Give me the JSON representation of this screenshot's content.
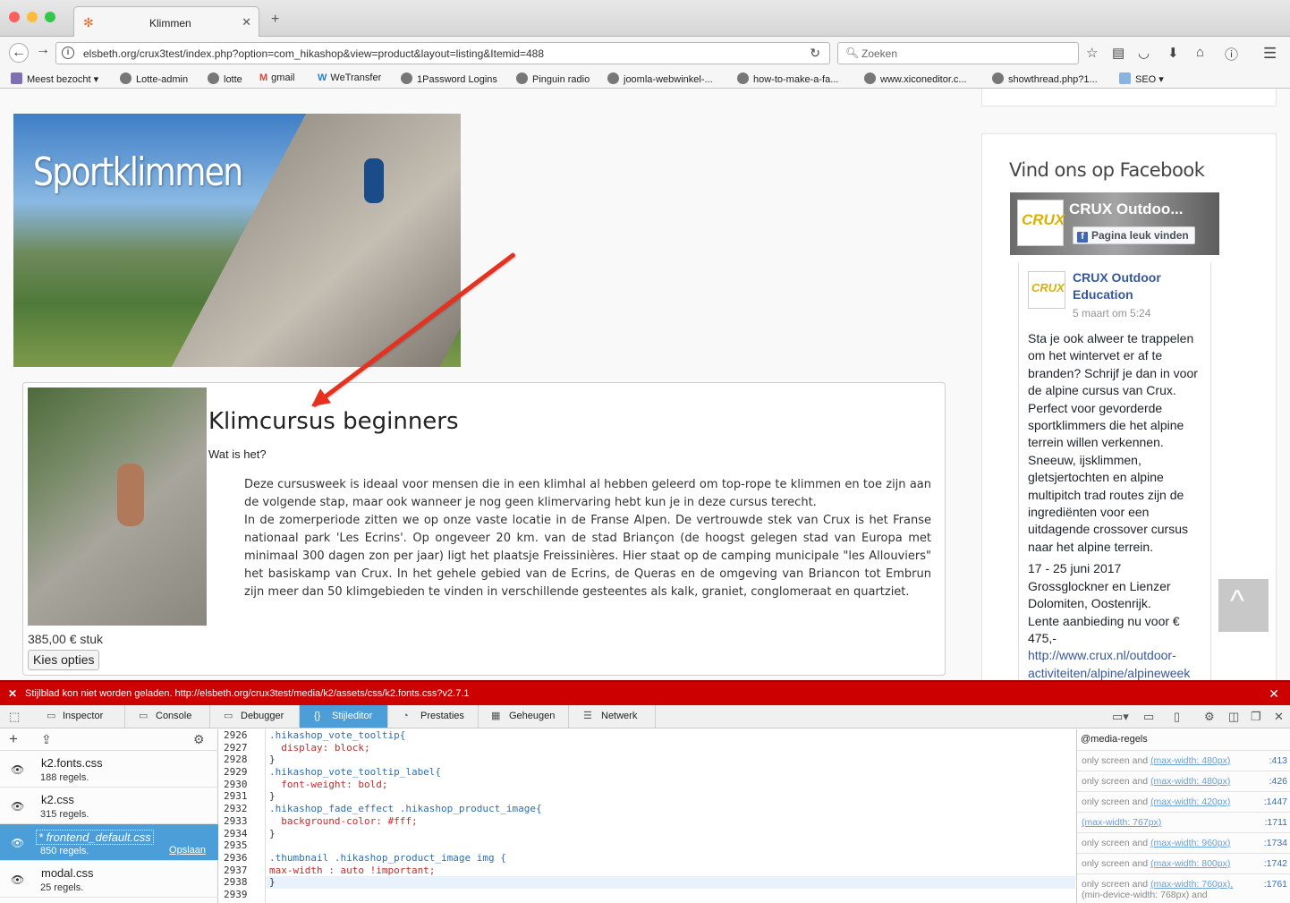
{
  "browser": {
    "tab_title": "Klimmen",
    "url": "elsbeth.org/crux3test/index.php?option=com_hikashop&view=product&layout=listing&Itemid=488",
    "search_placeholder": "Zoeken",
    "bookmarks": [
      "Meest bezocht",
      "Lotte-admin",
      "lotte",
      "gmail",
      "WeTransfer",
      "1Password Logins",
      "Pinguin radio",
      "joomla-webwinkel-...",
      "how-to-make-a-fa...",
      "www.xiconeditor.c...",
      "showthread.php?1...",
      "SEO"
    ]
  },
  "banner": {
    "title": "Sportklimmen"
  },
  "product": {
    "title": "Klimcursus beginners",
    "subtitle": "Wat is het?",
    "desc1": "Deze cursusweek is ideaal voor mensen die in een klimhal al hebben geleerd om top-rope te klimmen en toe zijn aan de volgende stap, maar ook wanneer je nog geen klimervaring hebt kun je in deze cursus terecht.",
    "desc2": "In de zomerperiode zitten we op onze vaste locatie in de Franse Alpen. De vertrouwde stek van Crux is het Franse nationaal park 'Les Ecrins'. Op ongeveer 20 km. van de stad Briançon (de hoogst gelegen stad van Europa met minimaal 300 dagen zon per jaar) ligt het plaatsje Freissinières. Hier staat op de camping municipale \"les Allouviers\" het basiskamp van Crux. In het gehele gebied van de Ecrins, de Queras en de omgeving van Briancon tot Embrun zijn meer dan 50 klimgebieden te vinden in verschillende gesteentes als kalk, graniet, conglomeraat en quartziet.",
    "price": "385,00 € stuk",
    "button": "Kies opties"
  },
  "sidebar": {
    "title": "Vind ons op Facebook",
    "page_name": "CRUX Outdoo...",
    "like": "Pagina leuk vinden",
    "logo_text": "CRUX",
    "post_name": "CRUX Outdoor Education",
    "post_date": "5 maart om 5:24",
    "post_text": "Sta je ook alweer te trappelen om het wintervet er af te branden? Schrijf je dan in voor de alpine cursus van Crux. Perfect voor gevorderde sportklimmers die het alpine terrein willen verkennen. Sneeuw, ijsklimmen, gletsjertochten en alpine multipitch trad routes zijn de ingrediënten voor een uitdagende crossover cursus naar het alpine terrein.",
    "post_dates": "17 - 25 juni 2017",
    "post_place": "Grossglockner en Lienzer Dolomiten, Oostenrijk.",
    "post_offer": "Lente aanbieding nu voor € 475,-",
    "post_link": "http://www.crux.nl/outdoor-activiteiten/alpine/alpineweek"
  },
  "devtools": {
    "error": "Stijlblad kon niet worden geladen. http://elsbeth.org/crux3test/media/k2/assets/css/k2.fonts.css?v2.7.1",
    "tabs": [
      "Inspector",
      "Console",
      "Debugger",
      "Stijleditor",
      "Prestaties",
      "Geheugen",
      "Netwerk"
    ],
    "active_tab": "Stijleditor",
    "sheets": [
      {
        "name": "k2.fonts.css",
        "rules": "188 regels."
      },
      {
        "name": "k2.css",
        "rules": "315 regels."
      },
      {
        "name": "* frontend_default.css",
        "rules": "850 regels.",
        "save": "Opslaan"
      },
      {
        "name": "modal.css",
        "rules": "25 regels."
      }
    ],
    "line_numbers": [
      "2926",
      "2927",
      "2928",
      "2929",
      "2930",
      "2931",
      "2932",
      "2933",
      "2934",
      "2935",
      "2936",
      "2937",
      "2938",
      "2939"
    ],
    "code": [
      ".hikashop_vote_tooltip{",
      "  display: block;",
      "}",
      ".hikashop_vote_tooltip_label{",
      "  font-weight: bold;",
      "}",
      ".hikashop_fade_effect .hikashop_product_image{",
      "  background-color: #fff;",
      "}",
      "",
      ".thumbnail .hikashop_product_image img {",
      "max-width : auto !important;",
      "}",
      ""
    ],
    "media_header": "@media-regels",
    "media": [
      {
        "pre": "only screen and ",
        "q": "(max-width: 480px)",
        "line": ":413"
      },
      {
        "pre": "only screen and ",
        "q": "(max-width: 480px)",
        "line": ":426"
      },
      {
        "pre": "only screen and ",
        "q": "(max-width: 420px)",
        "line": ":1447"
      },
      {
        "pre": "",
        "q": "(max-width: 767px)",
        "line": ":1711"
      },
      {
        "pre": "only screen and ",
        "q": "(max-width: 960px)",
        "line": ":1734"
      },
      {
        "pre": "only screen and ",
        "q": "(max-width: 800px)",
        "line": ":1742"
      },
      {
        "pre": "only screen and ",
        "q": "(max-width: 760px),",
        "line": ":1761"
      }
    ],
    "media_extra": "(min-device-width: 768px) and"
  }
}
